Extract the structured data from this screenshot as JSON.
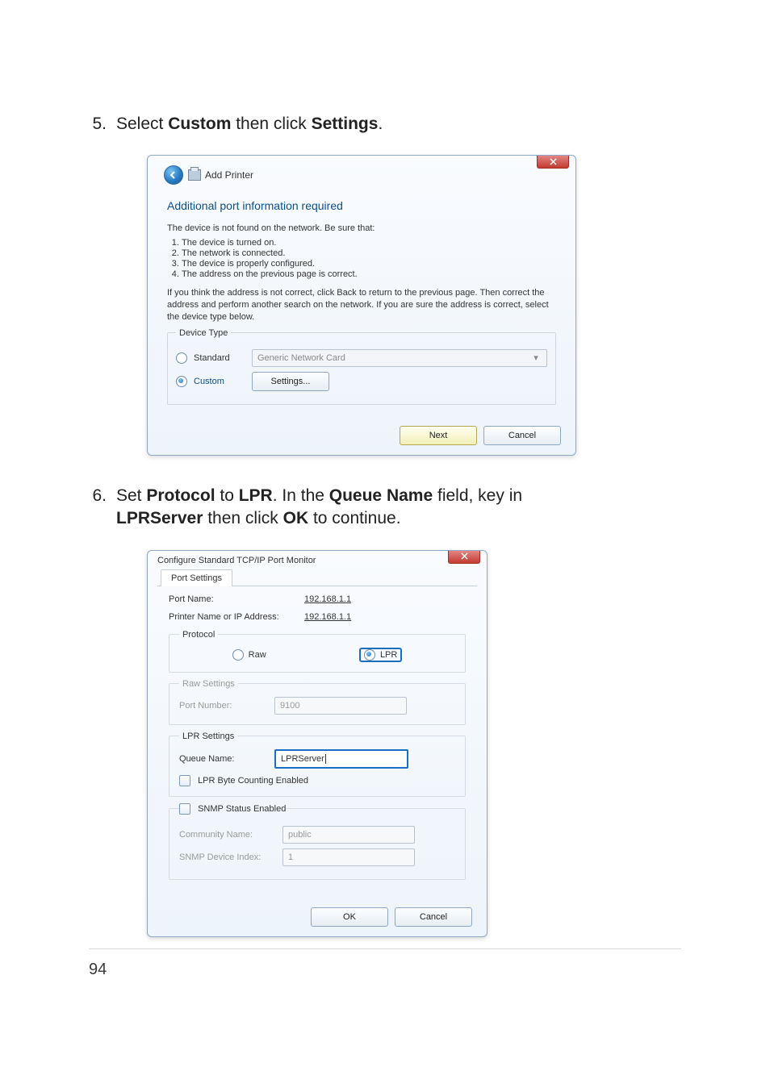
{
  "step5": {
    "number": "5.",
    "text_prefix": "Select ",
    "bold1": "Custom",
    "text_mid": " then click ",
    "bold2": "Settings",
    "text_suffix": "."
  },
  "step6": {
    "number": "6.",
    "line1_prefix": "Set ",
    "b1": "Protocol",
    "line1_mid1": " to ",
    "b2": "LPR",
    "line1_mid2": ". In the ",
    "b3": "Queue Name",
    "line1_mid3": " field, key in ",
    "b4": "LPRServer",
    "line2_mid": " then click ",
    "b5": "OK",
    "line2_suffix": " to continue."
  },
  "dialog1": {
    "title": "Add Printer",
    "heading": "Additional port information required",
    "intro": "The device is not found on the network.  Be sure that:",
    "items": [
      "The device is turned on.",
      "The network is connected.",
      "The device is properly configured.",
      "The address on the previous page is correct."
    ],
    "para": "If you think the address is not correct, click Back to return to the previous page.  Then correct the address and perform another search on the network.  If you are sure the address is correct, select the device type below.",
    "device_type_legend": "Device Type",
    "standard_label": "Standard",
    "standard_value": "Generic Network Card",
    "custom_label": "Custom",
    "settings_btn": "Settings...",
    "next_btn": "Next",
    "cancel_btn": "Cancel"
  },
  "dialog2": {
    "title": "Configure Standard TCP/IP Port Monitor",
    "tab": "Port Settings",
    "port_name_lbl": "Port Name:",
    "port_name_val": "192.168.1.1",
    "printer_lbl": "Printer Name or IP Address:",
    "printer_val": "192.168.1.1",
    "protocol_legend": "Protocol",
    "raw_label": "Raw",
    "lpr_label": "LPR",
    "raw_settings_legend": "Raw Settings",
    "port_number_lbl": "Port Number:",
    "port_number_val": "9100",
    "lpr_settings_legend": "LPR Settings",
    "queue_name_lbl": "Queue Name:",
    "queue_name_val": "LPRServer",
    "lpr_byte_label": "LPR Byte Counting Enabled",
    "snmp_label": "SNMP Status Enabled",
    "community_lbl": "Community Name:",
    "community_val": "public",
    "snmp_idx_lbl": "SNMP Device Index:",
    "snmp_idx_val": "1",
    "ok_btn": "OK",
    "cancel_btn": "Cancel"
  },
  "page_number": "94"
}
